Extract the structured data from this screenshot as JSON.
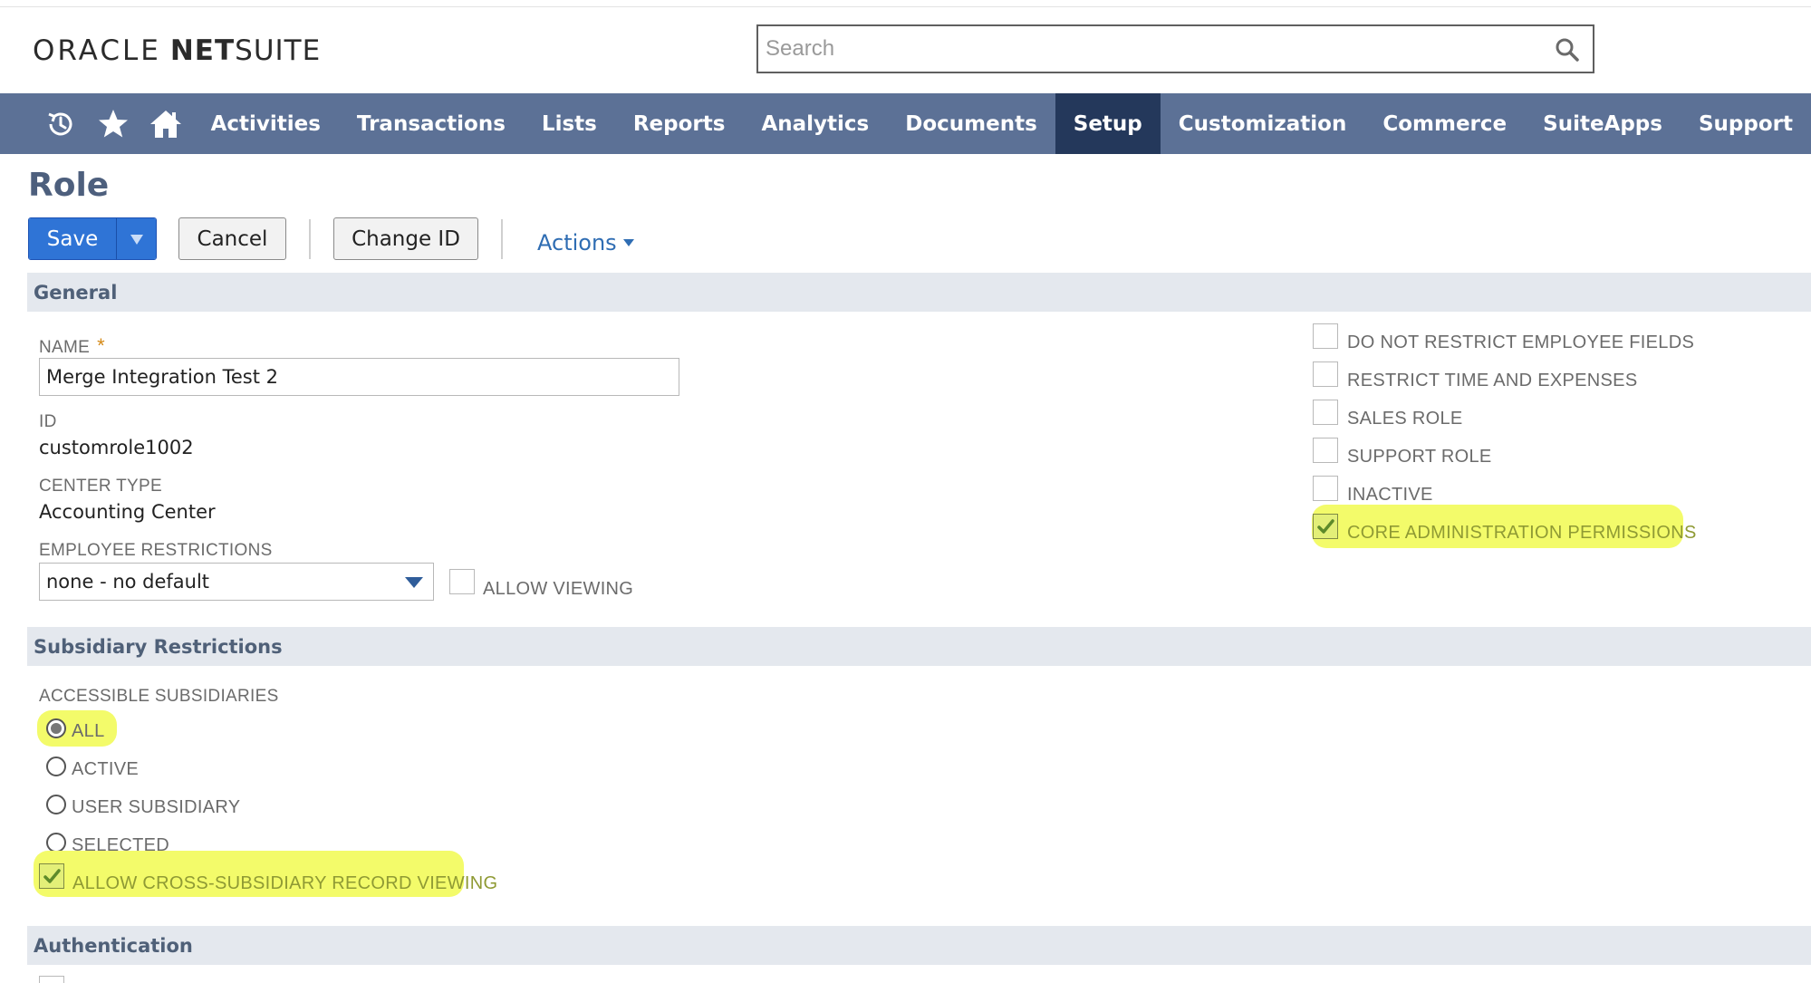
{
  "header": {
    "logo": {
      "oracle": "ORACLE",
      "net": "NET",
      "suite": "SUITE"
    },
    "search_placeholder": "Search"
  },
  "nav": {
    "icons": [
      "recent-history-icon",
      "star-icon",
      "home-icon"
    ],
    "items": [
      {
        "label": "Activities",
        "active": false
      },
      {
        "label": "Transactions",
        "active": false
      },
      {
        "label": "Lists",
        "active": false
      },
      {
        "label": "Reports",
        "active": false
      },
      {
        "label": "Analytics",
        "active": false
      },
      {
        "label": "Documents",
        "active": false
      },
      {
        "label": "Setup",
        "active": true
      },
      {
        "label": "Customization",
        "active": false
      },
      {
        "label": "Commerce",
        "active": false
      },
      {
        "label": "SuiteApps",
        "active": false
      },
      {
        "label": "Support",
        "active": false
      }
    ]
  },
  "page": {
    "title": "Role",
    "toolbar": {
      "save": "Save",
      "cancel": "Cancel",
      "change_id": "Change ID",
      "actions": "Actions"
    }
  },
  "general": {
    "section_title": "General",
    "name_label": "NAME",
    "required_mark": "*",
    "name_value": "Merge Integration Test 2",
    "id_label": "ID",
    "id_value": "customrole1002",
    "center_type_label": "CENTER TYPE",
    "center_type_value": "Accounting Center",
    "employee_restrictions_label": "EMPLOYEE RESTRICTIONS",
    "employee_restrictions_value": "none - no default",
    "allow_viewing": {
      "label": "ALLOW VIEWING",
      "checked": false
    },
    "right_checkboxes": [
      {
        "label": "DO NOT RESTRICT EMPLOYEE FIELDS",
        "checked": false
      },
      {
        "label": "RESTRICT TIME AND EXPENSES",
        "checked": false
      },
      {
        "label": "SALES ROLE",
        "checked": false
      },
      {
        "label": "SUPPORT ROLE",
        "checked": false
      },
      {
        "label": "INACTIVE",
        "checked": false
      },
      {
        "label": "CORE ADMINISTRATION PERMISSIONS",
        "checked": true
      }
    ]
  },
  "subsidiary": {
    "section_title": "Subsidiary Restrictions",
    "accessible_label": "ACCESSIBLE SUBSIDIARIES",
    "options": [
      {
        "label": "ALL",
        "selected": true
      },
      {
        "label": "ACTIVE",
        "selected": false
      },
      {
        "label": "USER SUBSIDIARY",
        "selected": false
      },
      {
        "label": "SELECTED",
        "selected": false
      }
    ],
    "cross_subsidiary": {
      "label": "ALLOW CROSS-SUBSIDIARY RECORD VIEWING",
      "checked": true
    }
  },
  "authentication": {
    "section_title": "Authentication"
  },
  "colors": {
    "nav_bg": "#5c7196",
    "nav_active": "#24385b",
    "primary_button": "#2f74d6",
    "section_bg": "#e4e8ee",
    "highlight": "#f3fb6a"
  }
}
